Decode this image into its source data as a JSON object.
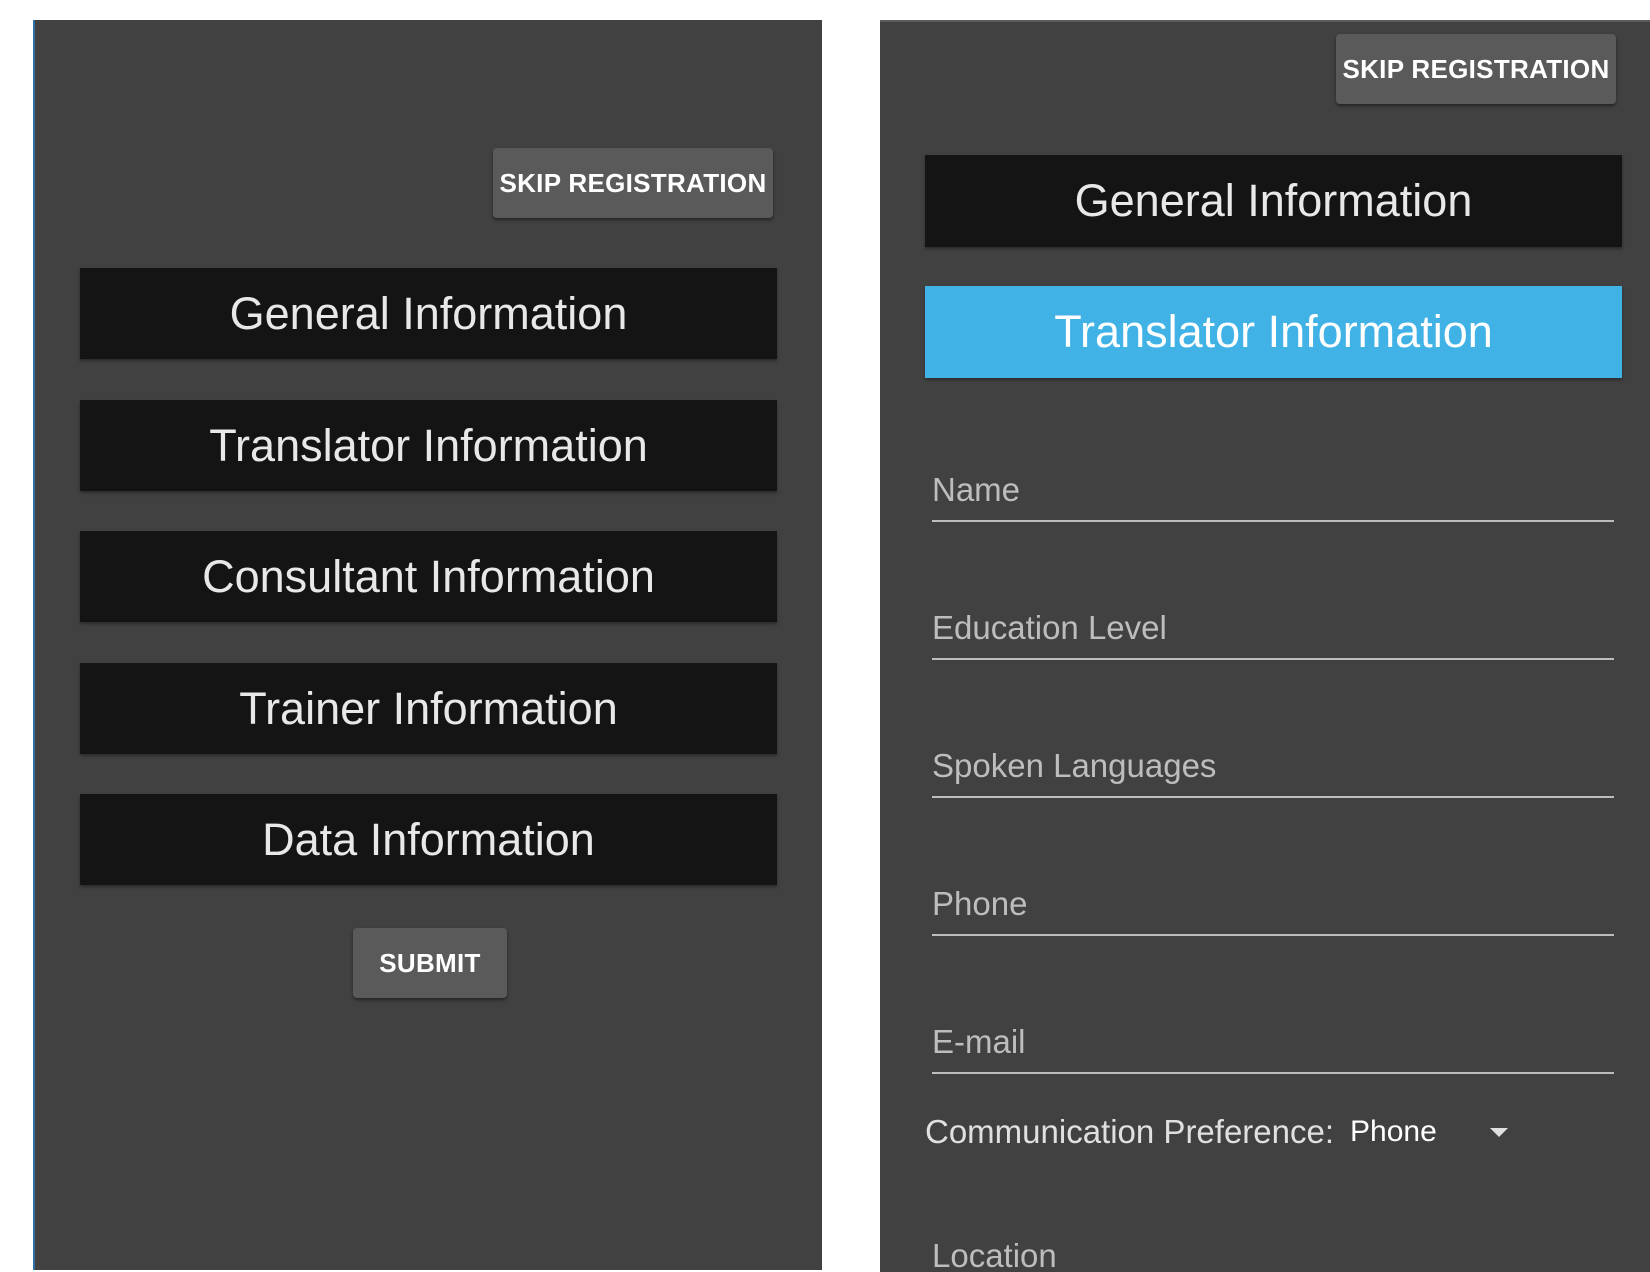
{
  "left_screen": {
    "skip_label": "SKIP REGISTRATION",
    "sections": [
      {
        "label": "General Information"
      },
      {
        "label": "Translator Information"
      },
      {
        "label": "Consultant Information"
      },
      {
        "label": "Trainer Information"
      },
      {
        "label": "Data Information"
      }
    ],
    "submit_label": "SUBMIT"
  },
  "right_screen": {
    "skip_label": "SKIP REGISTRATION",
    "sections": [
      {
        "label": "General Information"
      },
      {
        "label": "Translator Information",
        "active": true
      }
    ],
    "fields": [
      {
        "placeholder": "Name",
        "value": ""
      },
      {
        "placeholder": "Education Level",
        "value": ""
      },
      {
        "placeholder": "Spoken Languages",
        "value": ""
      },
      {
        "placeholder": "Phone",
        "value": ""
      },
      {
        "placeholder": "E-mail",
        "value": ""
      }
    ],
    "communication_preference": {
      "label": "Communication Preference:",
      "selected": "Phone"
    },
    "location_field": {
      "placeholder": "Location",
      "value": ""
    }
  },
  "colors": {
    "panel_bg": "#414141",
    "section_bg": "#141414",
    "active_section_bg": "#41b2e5",
    "button_bg": "#5a5a5a"
  }
}
